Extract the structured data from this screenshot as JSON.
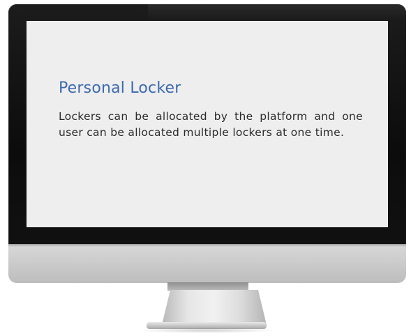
{
  "card": {
    "title": "Personal Locker",
    "description": "Lockers can be allocated by the platform and one user can be allocated multiple lockers at one time."
  },
  "colors": {
    "title": "#3d6aad",
    "body_text": "#2b2b2b",
    "screen_background": "#eeeeee",
    "bezel": "#111111",
    "chin": "#cfcfcf"
  }
}
